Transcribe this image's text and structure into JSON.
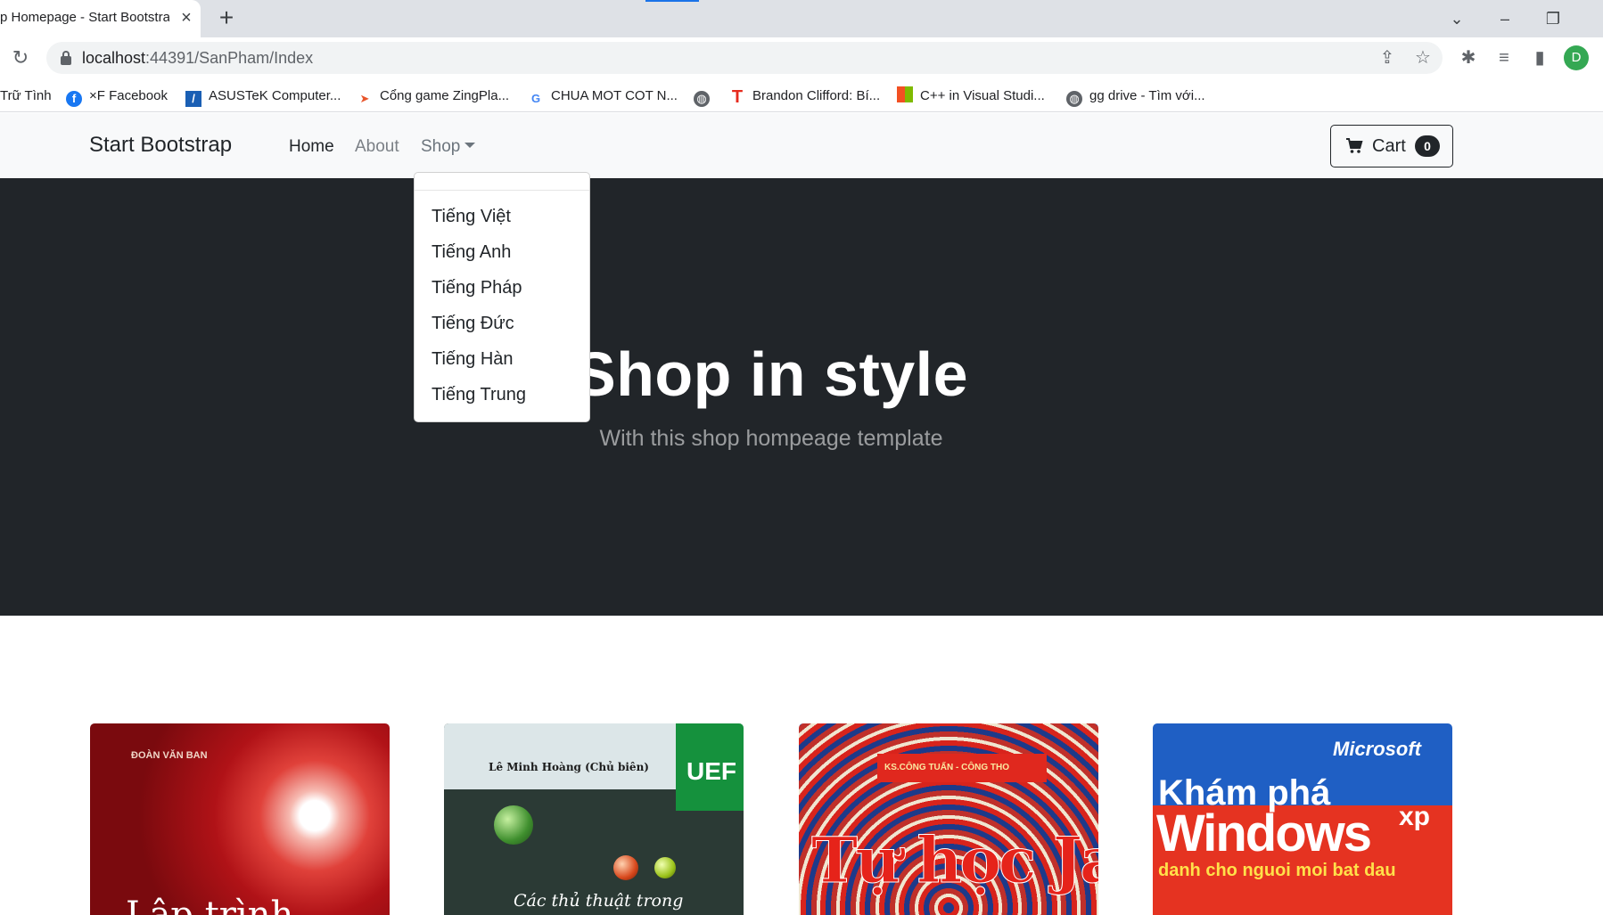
{
  "browser": {
    "tab_title": "p Homepage - Start Bootstrap",
    "tab_close": "×",
    "new_tab": "+",
    "url_host": "localhost",
    "url_path": ":44391/SanPham/Index",
    "profile_initial": "D",
    "bookmarks": [
      {
        "label": "Trữ Tình",
        "icon": "none"
      },
      {
        "label": "×F Facebook",
        "icon": "facebook-icon"
      },
      {
        "label": "ASUSTeK Computer...",
        "icon": "asus-icon"
      },
      {
        "label": "Cổng game ZingPla...",
        "icon": "zing-icon"
      },
      {
        "label": "CHUA MOT COT N...",
        "icon": "google-icon"
      },
      {
        "label": "",
        "icon": "globe-icon"
      },
      {
        "label": "Brandon Clifford: Bí...",
        "icon": "ted-icon"
      },
      {
        "label": "C++ in Visual Studi...",
        "icon": "microsoft-icon"
      },
      {
        "label": "gg drive - Tìm với...",
        "icon": "globe-icon"
      }
    ]
  },
  "navbar": {
    "brand": "Start Bootstrap",
    "links": [
      "Home",
      "About",
      "Shop"
    ],
    "cart_label": "Cart",
    "cart_count": "0"
  },
  "dropdown": {
    "items": [
      "Tiếng Việt",
      "Tiếng Anh",
      "Tiếng Pháp",
      "Tiếng Đức",
      "Tiếng Hàn",
      "Tiếng Trung"
    ]
  },
  "hero": {
    "title": "Shop in style",
    "subtitle": "With this shop hompeage template"
  },
  "products": [
    {
      "cover_author": "ĐOÀN VĂN BAN",
      "cover_title": "Lập trình"
    },
    {
      "cover_author": "Lê Minh Hoàng (Chủ biên)",
      "cover_badge": "UEF",
      "cover_title": "Các thủ thuật trong"
    },
    {
      "cover_author": "KS.CÔNG TUẤN - CÔNG THO",
      "cover_title": "Tự học JavaScript"
    },
    {
      "cover_brand": "Microsoft",
      "cover_title_1": "Khám phá",
      "cover_title_2": "Windows",
      "cover_title_xp": "xp",
      "cover_subtitle": "danh cho nguoi moi bat dau"
    }
  ],
  "colors": {
    "hero_bg": "#212529",
    "navbar_bg": "#f8f9fa",
    "chrome_bg": "#dee1e6"
  }
}
